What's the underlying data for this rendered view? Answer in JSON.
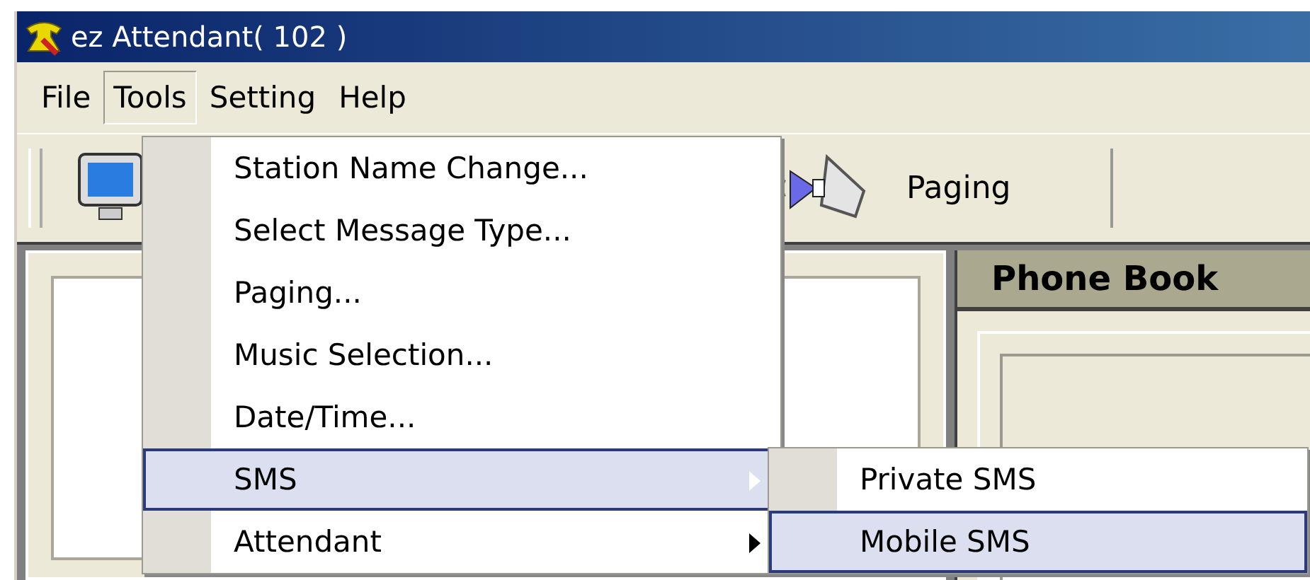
{
  "window": {
    "title": "ez Attendant( 102 )"
  },
  "menu_bar": [
    {
      "label": "File",
      "selected": false
    },
    {
      "label": "Tools",
      "selected": true
    },
    {
      "label": "Setting",
      "selected": false
    },
    {
      "label": "Help",
      "selected": false
    }
  ],
  "toolbar": {
    "buttons": [
      {
        "label": "Paging"
      }
    ]
  },
  "phone_book": {
    "title": "Phone Book"
  },
  "tools_menu": [
    {
      "label": "Station Name Change...",
      "selected": false,
      "has_submenu": false
    },
    {
      "label": "Select Message Type...",
      "selected": false,
      "has_submenu": false
    },
    {
      "label": "Paging...",
      "selected": false,
      "has_submenu": false
    },
    {
      "label": "Music Selection...",
      "selected": false,
      "has_submenu": false
    },
    {
      "label": "Date/Time...",
      "selected": false,
      "has_submenu": false
    },
    {
      "label": "SMS",
      "selected": true,
      "has_submenu": true
    },
    {
      "label": "Attendant",
      "selected": false,
      "has_submenu": true
    }
  ],
  "sms_submenu": [
    {
      "label": "Private SMS",
      "selected": false
    },
    {
      "label": "Mobile SMS",
      "selected": true
    }
  ]
}
